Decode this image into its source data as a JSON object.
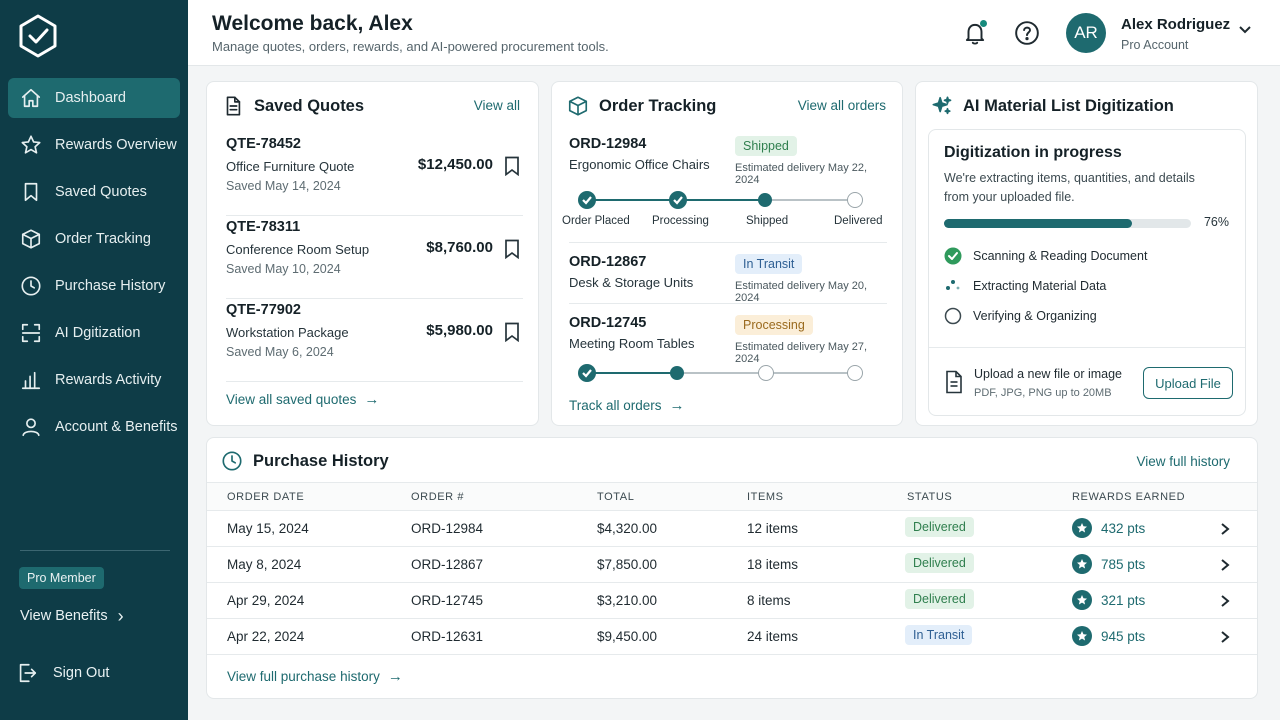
{
  "header": {
    "welcome": "Welcome back, Alex",
    "subtitle": "Manage quotes, orders, rewards, and AI-powered procurement tools.",
    "user_name": "Alex Rodriguez",
    "user_role": "Pro Account",
    "avatar_initials": "AR"
  },
  "sidebar": {
    "items": [
      {
        "label": "Dashboard",
        "icon": "home-icon"
      },
      {
        "label": "Rewards Overview",
        "icon": "star-icon"
      },
      {
        "label": "Saved Quotes",
        "icon": "bookmark-icon"
      },
      {
        "label": "Order Tracking",
        "icon": "box-icon"
      },
      {
        "label": "Purchase History",
        "icon": "clock-icon"
      },
      {
        "label": "AI Dgitization",
        "icon": "scan-icon"
      },
      {
        "label": "Rewards Activity",
        "icon": "bar-chart-icon"
      },
      {
        "label": "Account & Benefits",
        "icon": "user-icon"
      }
    ],
    "pro_badge": "Pro Member",
    "view_benefits": "View Benefits",
    "sign_out": "Sign Out"
  },
  "saved_quotes": {
    "title": "Saved Quotes",
    "view_all": "View all",
    "footer_link": "View all saved quotes",
    "items": [
      {
        "id": "QTE-78452",
        "name": "Office Furniture Quote",
        "date": "Saved May 14, 2024",
        "amount": "$12,450.00"
      },
      {
        "id": "QTE-78311",
        "name": "Conference Room Setup",
        "date": "Saved May 10, 2024",
        "amount": "$8,760.00"
      },
      {
        "id": "QTE-77902",
        "name": "Workstation Package",
        "date": "Saved May 6, 2024",
        "amount": "$5,980.00"
      }
    ]
  },
  "order_tracking": {
    "title": "Order Tracking",
    "view_all": "View all orders",
    "footer_link": "Track all orders",
    "orders": [
      {
        "id": "ORD-12984",
        "name": "Ergonomic Office Chairs",
        "status": "Shipped",
        "eta": "Estimated delivery May 22, 2024"
      },
      {
        "id": "ORD-12867",
        "name": "Desk & Storage Units",
        "status": "In Transit",
        "eta": "Estimated delivery May 20, 2024"
      },
      {
        "id": "ORD-12745",
        "name": "Meeting Room Tables",
        "status": "Processing",
        "eta": "Estimated delivery May 27, 2024"
      }
    ],
    "step_labels": [
      "Order Placed",
      "Processing",
      "Shipped",
      "Delivered"
    ]
  },
  "ai_digitization": {
    "title": "AI Material List Digitization",
    "status_title": "Digitization in progress",
    "description": "We're extracting items, quantities, and details from your uploaded file.",
    "progress": 76,
    "progress_label": "76%",
    "steps": [
      {
        "label": "Scanning & Reading Document",
        "state": "done"
      },
      {
        "label": "Extracting Material Data",
        "state": "active"
      },
      {
        "label": "Verifying & Organizing",
        "state": "pending"
      }
    ],
    "upload_title": "Upload a new file or image",
    "upload_sub": "PDF, JPG, PNG up to 20MB",
    "upload_button": "Upload File"
  },
  "purchase_history": {
    "title": "Purchase History",
    "view_full": "View full history",
    "footer_link": "View full purchase history",
    "columns": [
      "ORDER DATE",
      "ORDER #",
      "TOTAL",
      "ITEMS",
      "STATUS",
      "REWARDS EARNED"
    ],
    "rows": [
      {
        "date": "May 15, 2024",
        "order": "ORD-12984",
        "total": "$4,320.00",
        "items": "12 items",
        "status": "Delivered",
        "rewards": "432 pts"
      },
      {
        "date": "May 8, 2024",
        "order": "ORD-12867",
        "total": "$7,850.00",
        "items": "18 items",
        "status": "Delivered",
        "rewards": "785 pts"
      },
      {
        "date": "Apr 29, 2024",
        "order": "ORD-12745",
        "total": "$3,210.00",
        "items": "8 items",
        "status": "Delivered",
        "rewards": "321 pts"
      },
      {
        "date": "Apr 22, 2024",
        "order": "ORD-12631",
        "total": "$9,450.00",
        "items": "24 items",
        "status": "In Transit",
        "rewards": "945 pts"
      }
    ]
  },
  "colors": {
    "sidebar": "#0e3c47",
    "accent": "#1e6a6f",
    "delivered": "#2f7f4e",
    "transit": "#2e5f93",
    "processing": "#9a6a1e"
  }
}
